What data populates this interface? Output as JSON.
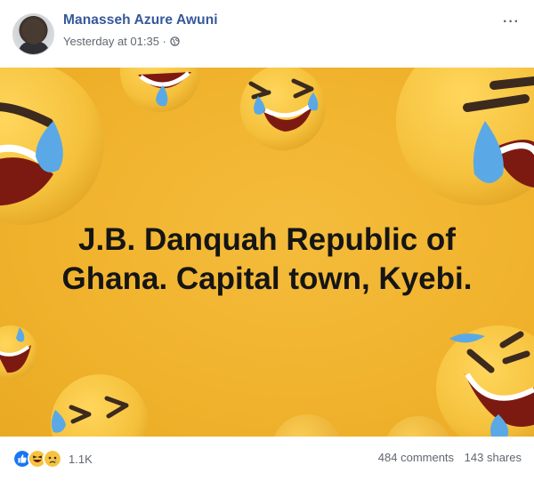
{
  "post": {
    "author_name": "Manasseh Azure Awuni",
    "timestamp": "Yesterday at 01:35 ·",
    "privacy_icon": "globe-icon",
    "more_label": "···",
    "image_caption_lines": [
      "J.B. Danquah Republic of",
      "Ghana. Capital town, Kyebi."
    ]
  },
  "footer": {
    "reaction_icons": [
      "like-icon",
      "haha-icon",
      "sad-icon"
    ],
    "reaction_count": "1.1K",
    "comments": "484 comments",
    "shares": "143 shares"
  },
  "colors": {
    "author_link": "#365899",
    "image_background": "#f1b32d",
    "emoji_yellow": "#f5c545",
    "tear_blue": "#5aa9e6",
    "like_blue": "#1877f2"
  }
}
